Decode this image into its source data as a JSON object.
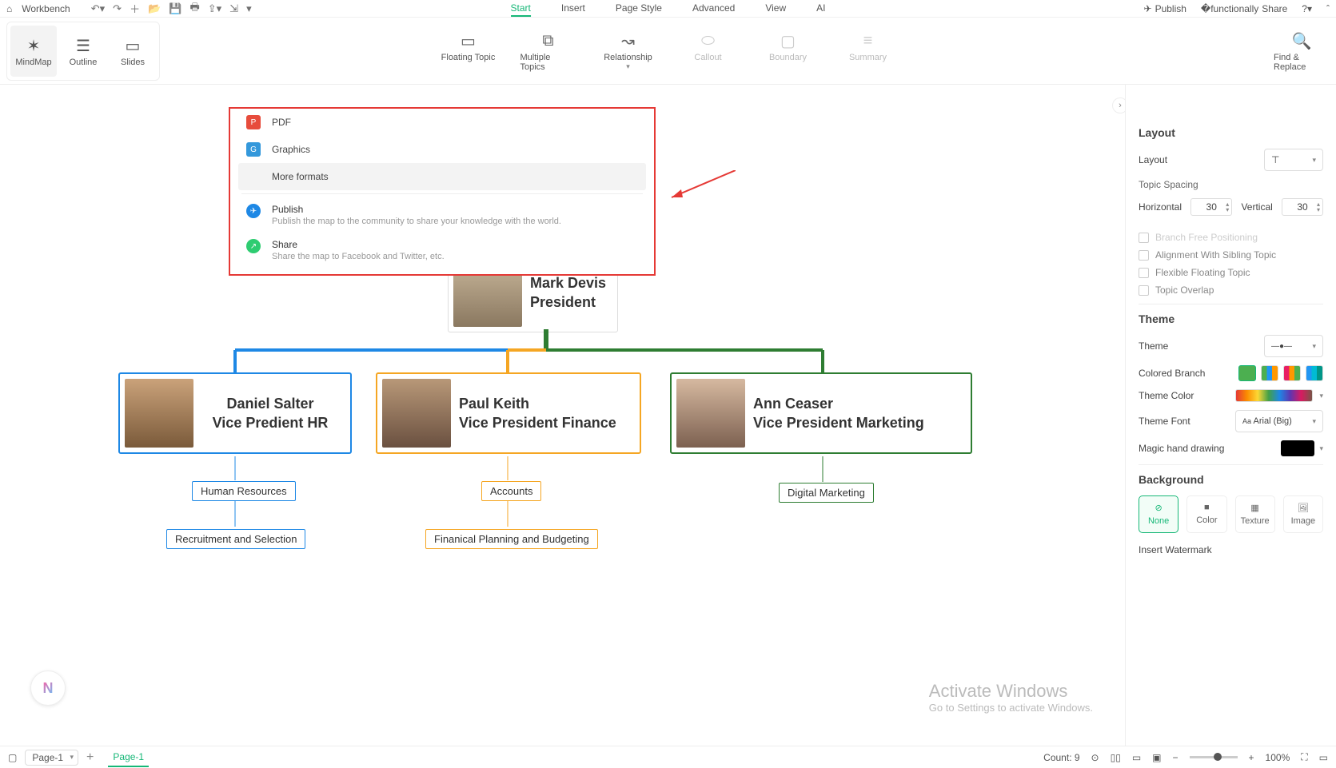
{
  "topbar": {
    "workbench": "Workbench",
    "menu": [
      "Start",
      "Insert",
      "Page Style",
      "Advanced",
      "View",
      "AI"
    ],
    "menu_active": 0,
    "publish": "Publish",
    "share": "Share"
  },
  "view_modes": [
    "MindMap",
    "Outline",
    "Slides"
  ],
  "ribbon_center": [
    {
      "key": "floating",
      "label": "Floating Topic",
      "dis": false
    },
    {
      "key": "multiple",
      "label": "Multiple Topics",
      "dis": false
    },
    {
      "key": "relationship",
      "label": "Relationship",
      "dis": false
    },
    {
      "key": "callout",
      "label": "Callout",
      "dis": true
    },
    {
      "key": "boundary",
      "label": "Boundary",
      "dis": true
    },
    {
      "key": "summary",
      "label": "Summary",
      "dis": true
    }
  ],
  "ribbon_right": {
    "find": "Find & Replace"
  },
  "export_popup": {
    "pdf": "PDF",
    "graphics": "Graphics",
    "more": "More formats",
    "publish_t": "Publish",
    "publish_s": "Publish the map to the community to share your knowledge with the world.",
    "share_t": "Share",
    "share_s": "Share the map to Facebook and Twitter, etc."
  },
  "chart_data": {
    "type": "org-tree",
    "root": {
      "name": "Mark Devis",
      "title": "President"
    },
    "children": [
      {
        "name": "Daniel Salter",
        "title": "Vice Predient HR",
        "color": "#1e88e5",
        "subs": [
          "Human Resources",
          "Recruitment and Selection"
        ]
      },
      {
        "name": "Paul Keith",
        "title": "Vice President Finance",
        "color": "#f5a623",
        "subs": [
          "Accounts",
          "Finanical Planning and Budgeting"
        ]
      },
      {
        "name": "Ann Ceaser",
        "title": "Vice President Marketing",
        "color": "#2e7d32",
        "subs": [
          "Digital Marketing"
        ]
      }
    ]
  },
  "right_panel": {
    "layout_h": "Layout",
    "layout_label": "Layout",
    "spacing_label": "Topic Spacing",
    "horizontal": "Horizontal",
    "horizontal_v": "30",
    "vertical": "Vertical",
    "vertical_v": "30",
    "checks": [
      "Branch Free Positioning",
      "Alignment With Sibling Topic",
      "Flexible Floating Topic",
      "Topic Overlap"
    ],
    "theme_h": "Theme",
    "theme_label": "Theme",
    "colored_branch": "Colored Branch",
    "theme_color": "Theme Color",
    "theme_font": "Theme Font",
    "theme_font_v": "Arial (Big)",
    "magic_hand": "Magic hand drawing",
    "background_h": "Background",
    "bg_opts": [
      "None",
      "Color",
      "Texture",
      "Image"
    ],
    "insert_wm": "Insert Watermark"
  },
  "statusbar": {
    "page_sel": "Page-1",
    "page_tab": "Page-1",
    "count": "Count: 9",
    "zoom": "100%"
  },
  "watermark": {
    "w1": "Activate Windows",
    "w2": "Go to Settings to activate Windows."
  }
}
